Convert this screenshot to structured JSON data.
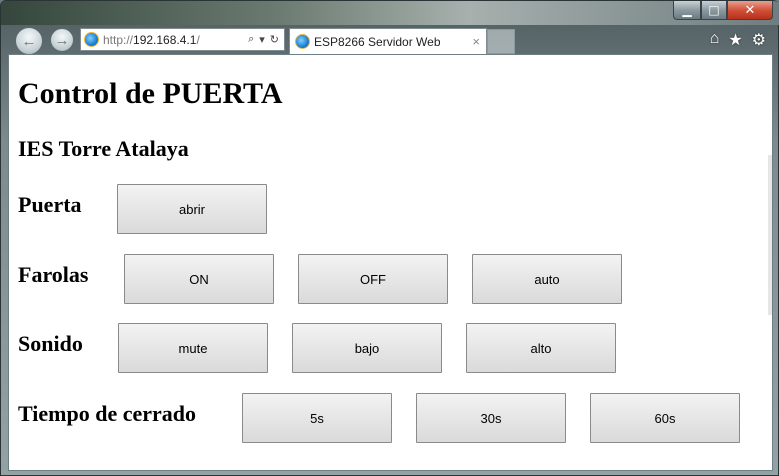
{
  "browser": {
    "url_protocol": "http://",
    "url_host": "192.168.4.1",
    "url_path": "/",
    "tab_title": "ESP8266 Servidor Web",
    "tab_close": "×",
    "min_glyph": "▁",
    "max_glyph": "□",
    "close_glyph": "✕",
    "back_glyph": "←",
    "forward_glyph": "→",
    "search_glyph": "⌕",
    "dropdown_glyph": "▾",
    "refresh_glyph": "↻",
    "home_glyph": "⌂",
    "favorites_glyph": "★",
    "tools_glyph": "⚙"
  },
  "page": {
    "title": "Control de PUERTA",
    "subtitle": "IES Torre Atalaya",
    "rows": [
      {
        "label": "Puerta",
        "buttons": [
          "abrir"
        ]
      },
      {
        "label": "Farolas",
        "buttons": [
          "ON",
          "OFF",
          "auto"
        ]
      },
      {
        "label": "Sonido",
        "buttons": [
          "mute",
          "bajo",
          "alto"
        ]
      },
      {
        "label": "Tiempo de cerrado",
        "buttons": [
          "5s",
          "30s",
          "60s"
        ]
      }
    ]
  }
}
